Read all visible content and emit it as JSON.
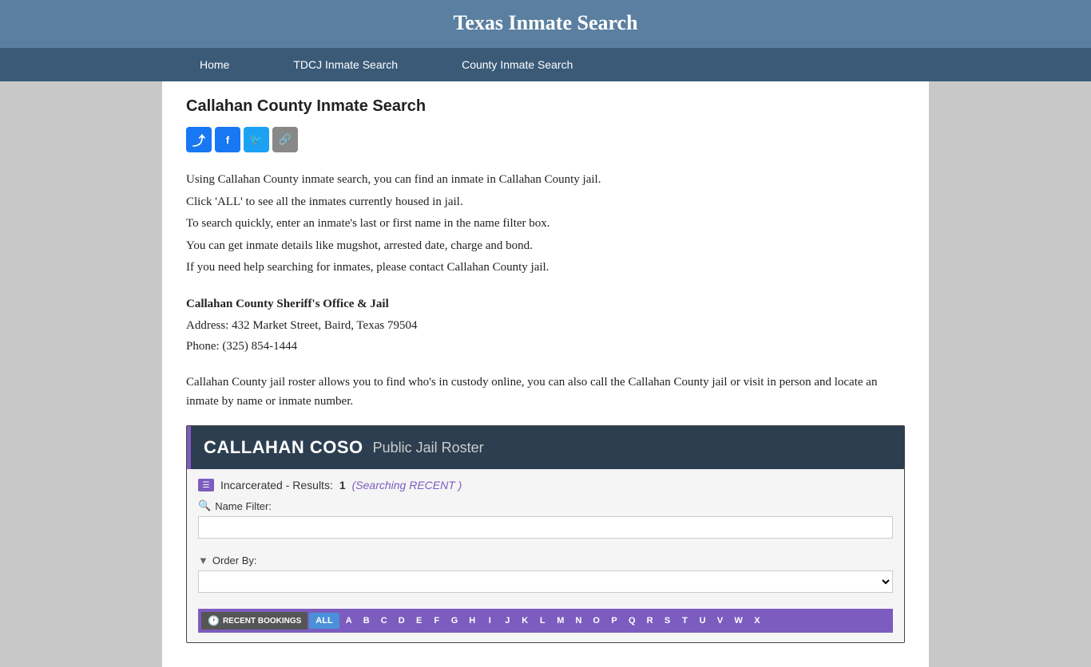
{
  "header": {
    "title": "Texas Inmate Search"
  },
  "nav": {
    "items": [
      {
        "label": "Home",
        "id": "home"
      },
      {
        "label": "TDCJ Inmate Search",
        "id": "tdcj"
      },
      {
        "label": "County Inmate Search",
        "id": "county"
      }
    ]
  },
  "page": {
    "heading": "Callahan County Inmate Search",
    "description_lines": [
      "Using Callahan County inmate search, you can find an inmate in Callahan County jail.",
      "Click 'ALL' to see all the inmates currently housed in jail.",
      "To search quickly, enter an inmate's last or first name in the name filter box.",
      "You can get inmate details like mugshot, arrested date, charge and bond.",
      "If you need help searching for inmates, please contact Callahan County jail."
    ],
    "sheriff_title": "Callahan County Sheriff's Office & Jail",
    "address": "Address: 432 Market Street, Baird, Texas 79504",
    "phone": "Phone: (325) 854-1444",
    "roster_para": "Callahan County jail roster allows you to find who's in custody online, you can also call the Callahan County jail or visit in person and locate an inmate by name or inmate number."
  },
  "roster": {
    "facility_name_bold": "CALLAHAN COSO",
    "facility_name_light": "Public Jail Roster",
    "incarcerated_label": "Incarcerated - Results:",
    "results_count": "1",
    "searching_text": "(Searching RECENT )",
    "name_filter_label": "Name Filter:",
    "order_by_label": "Order By:",
    "name_filter_placeholder": "",
    "order_by_placeholder": "",
    "recent_btn": "RECENT BOOKINGS",
    "all_btn": "ALL",
    "alpha_letters": [
      "A",
      "B",
      "C",
      "D",
      "E",
      "F",
      "G",
      "H",
      "I",
      "J",
      "K",
      "L",
      "M",
      "N",
      "O",
      "P",
      "Q",
      "R",
      "S",
      "T",
      "U",
      "V",
      "W",
      "X"
    ]
  },
  "social": {
    "share_symbol": "⤴",
    "facebook_symbol": "f",
    "twitter_symbol": "🐦",
    "link_symbol": "🔗"
  }
}
